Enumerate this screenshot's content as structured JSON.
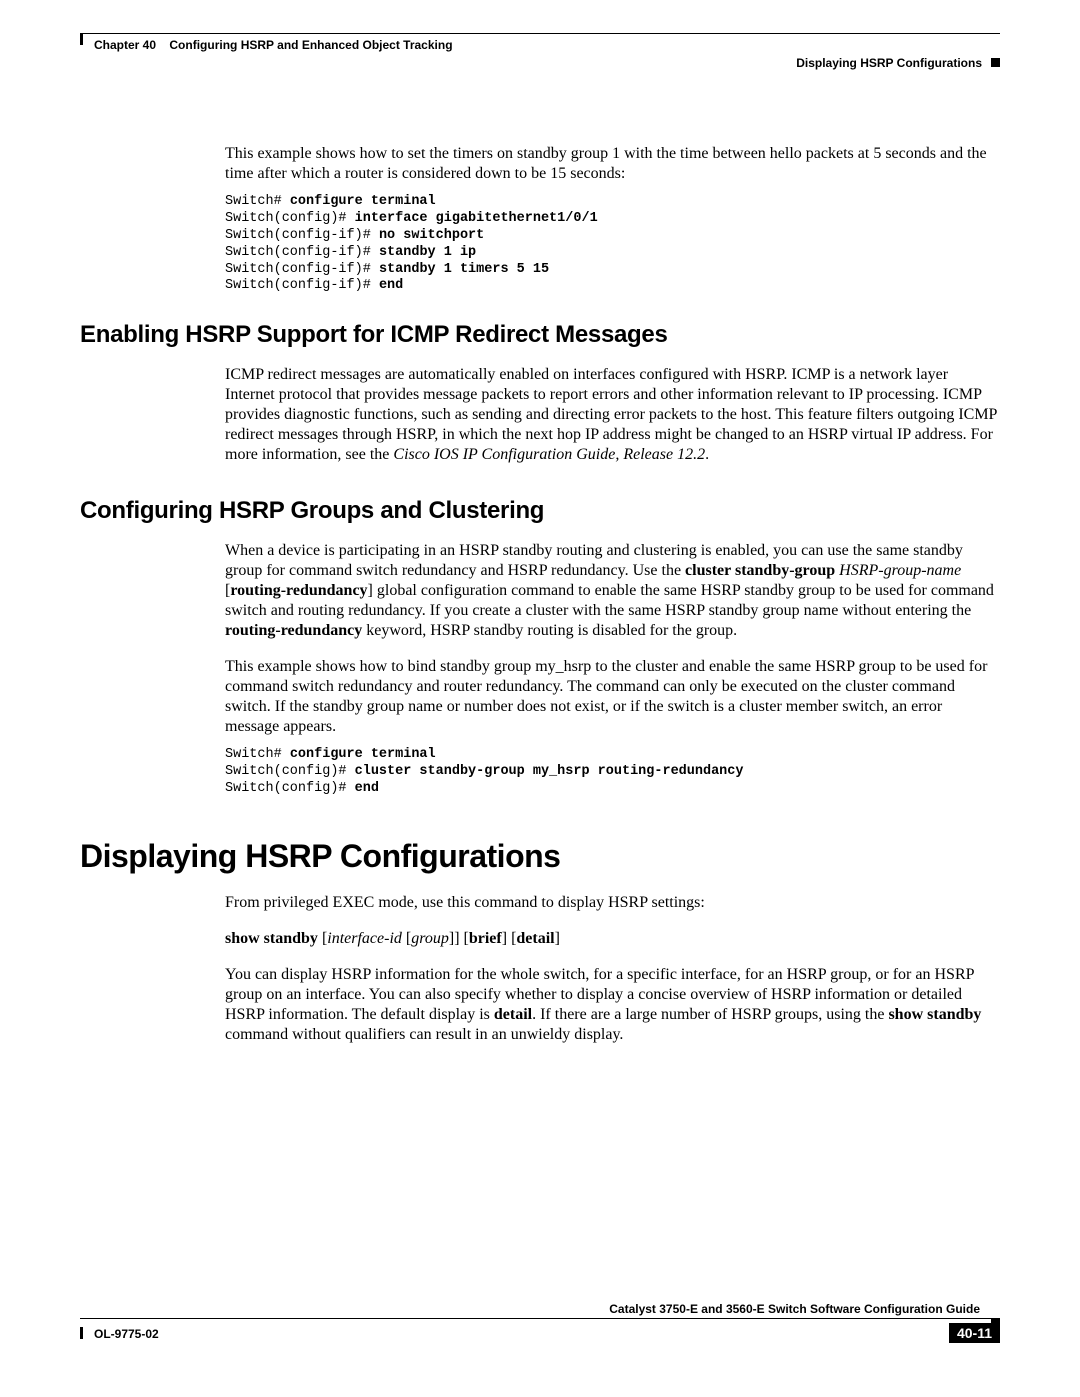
{
  "header": {
    "chapter_label": "Chapter 40",
    "chapter_title": "Configuring HSRP and Enhanced Object Tracking",
    "section_right": "Displaying HSRP Configurations"
  },
  "intro_para": "This example shows how to set the timers on standby group 1 with the time between hello packets at 5 seconds and the time after which a router is considered down to be 15 seconds:",
  "code1": {
    "l1p": "Switch# ",
    "l1b": "configure terminal",
    "l2p": "Switch(config)# ",
    "l2b": "interface gigabitethernet1/0/1",
    "l3p": "Switch(config-if)# ",
    "l3b": "no switchport",
    "l4p": "Switch(config-if)# ",
    "l4b": "standby 1 ip",
    "l5p": "Switch(config-if)# ",
    "l5b": "standby 1 timers 5 15",
    "l6p": "Switch(config-if)# ",
    "l6b": "end"
  },
  "h2_icmp": "Enabling HSRP Support for ICMP Redirect Messages",
  "icmp_para_a": "ICMP redirect messages are automatically enabled on interfaces configured with HSRP. ICMP is a network layer Internet protocol that provides message packets to report errors and other information relevant to IP processing. ICMP provides diagnostic functions, such as sending and directing error packets to the host. This feature filters outgoing ICMP redirect messages through HSRP, in which the next hop IP address might be changed to an HSRP virtual IP address. For more information, see the ",
  "icmp_para_em": "Cisco IOS IP Configuration Guide, Release 12.2",
  "period": ".",
  "h2_cluster": "Configuring HSRP Groups and Clustering",
  "cluster_p1_a": "When a device is participating in an HSRP standby routing and clustering is enabled, you can use the same standby group for command switch redundancy and HSRP redundancy. Use the ",
  "cluster_p1_b1": "cluster standby-group",
  "cluster_p1_sp1": " ",
  "cluster_p1_em": "HSRP-group-name",
  "cluster_p1_sp2": " [",
  "cluster_p1_b2": "routing-redundancy",
  "cluster_p1_c": "] global configuration command to enable the same HSRP standby group to be used for command switch and routing redundancy. If you create a cluster with the same HSRP standby group name without entering the ",
  "cluster_p1_b3": "routing-redundancy",
  "cluster_p1_d": " keyword, HSRP standby routing is disabled for the group.",
  "cluster_p2": "This example shows how to bind standby group my_hsrp to the cluster and enable the same HSRP group to be used for command switch redundancy and router redundancy. The command can only be executed on the cluster command switch. If the standby group name or number does not exist, or if the switch is a cluster member switch, an error message appears.",
  "code2": {
    "l1p": "Switch# ",
    "l1b": "configure terminal",
    "l2p": "Switch(config)# ",
    "l2b": "cluster standby-group my_hsrp routing-redundancy",
    "l3p": "Switch(config)# ",
    "l3b": "end"
  },
  "h1_display": "Displaying HSRP Configurations",
  "display_p1": "From privileged EXEC mode, use this command to display HSRP settings:",
  "syntax": {
    "b1": "show standby",
    "sp1": " [",
    "em1": "interface-id",
    "sp2": " [",
    "em2": "group",
    "sp3": "]] [",
    "b2": "brief",
    "sp4": "] [",
    "b3": "detail",
    "sp5": "]"
  },
  "display_p2_a": "You can display HSRP information for the whole switch, for a specific interface, for an HSRP group, or for an HSRP group on an interface. You can also specify whether to display a concise overview of HSRP information or detailed HSRP information. The default display is ",
  "display_p2_b1": "detail",
  "display_p2_b": ". If there are a large number of HSRP groups, using the ",
  "display_p2_b2": "show standby",
  "display_p2_c": " command without qualifiers can result in an unwieldy display.",
  "footer": {
    "doc_title": "Catalyst 3750-E and 3560-E Switch Software Configuration Guide",
    "doc_id": "OL-9775-02",
    "page_num": "40-11"
  }
}
